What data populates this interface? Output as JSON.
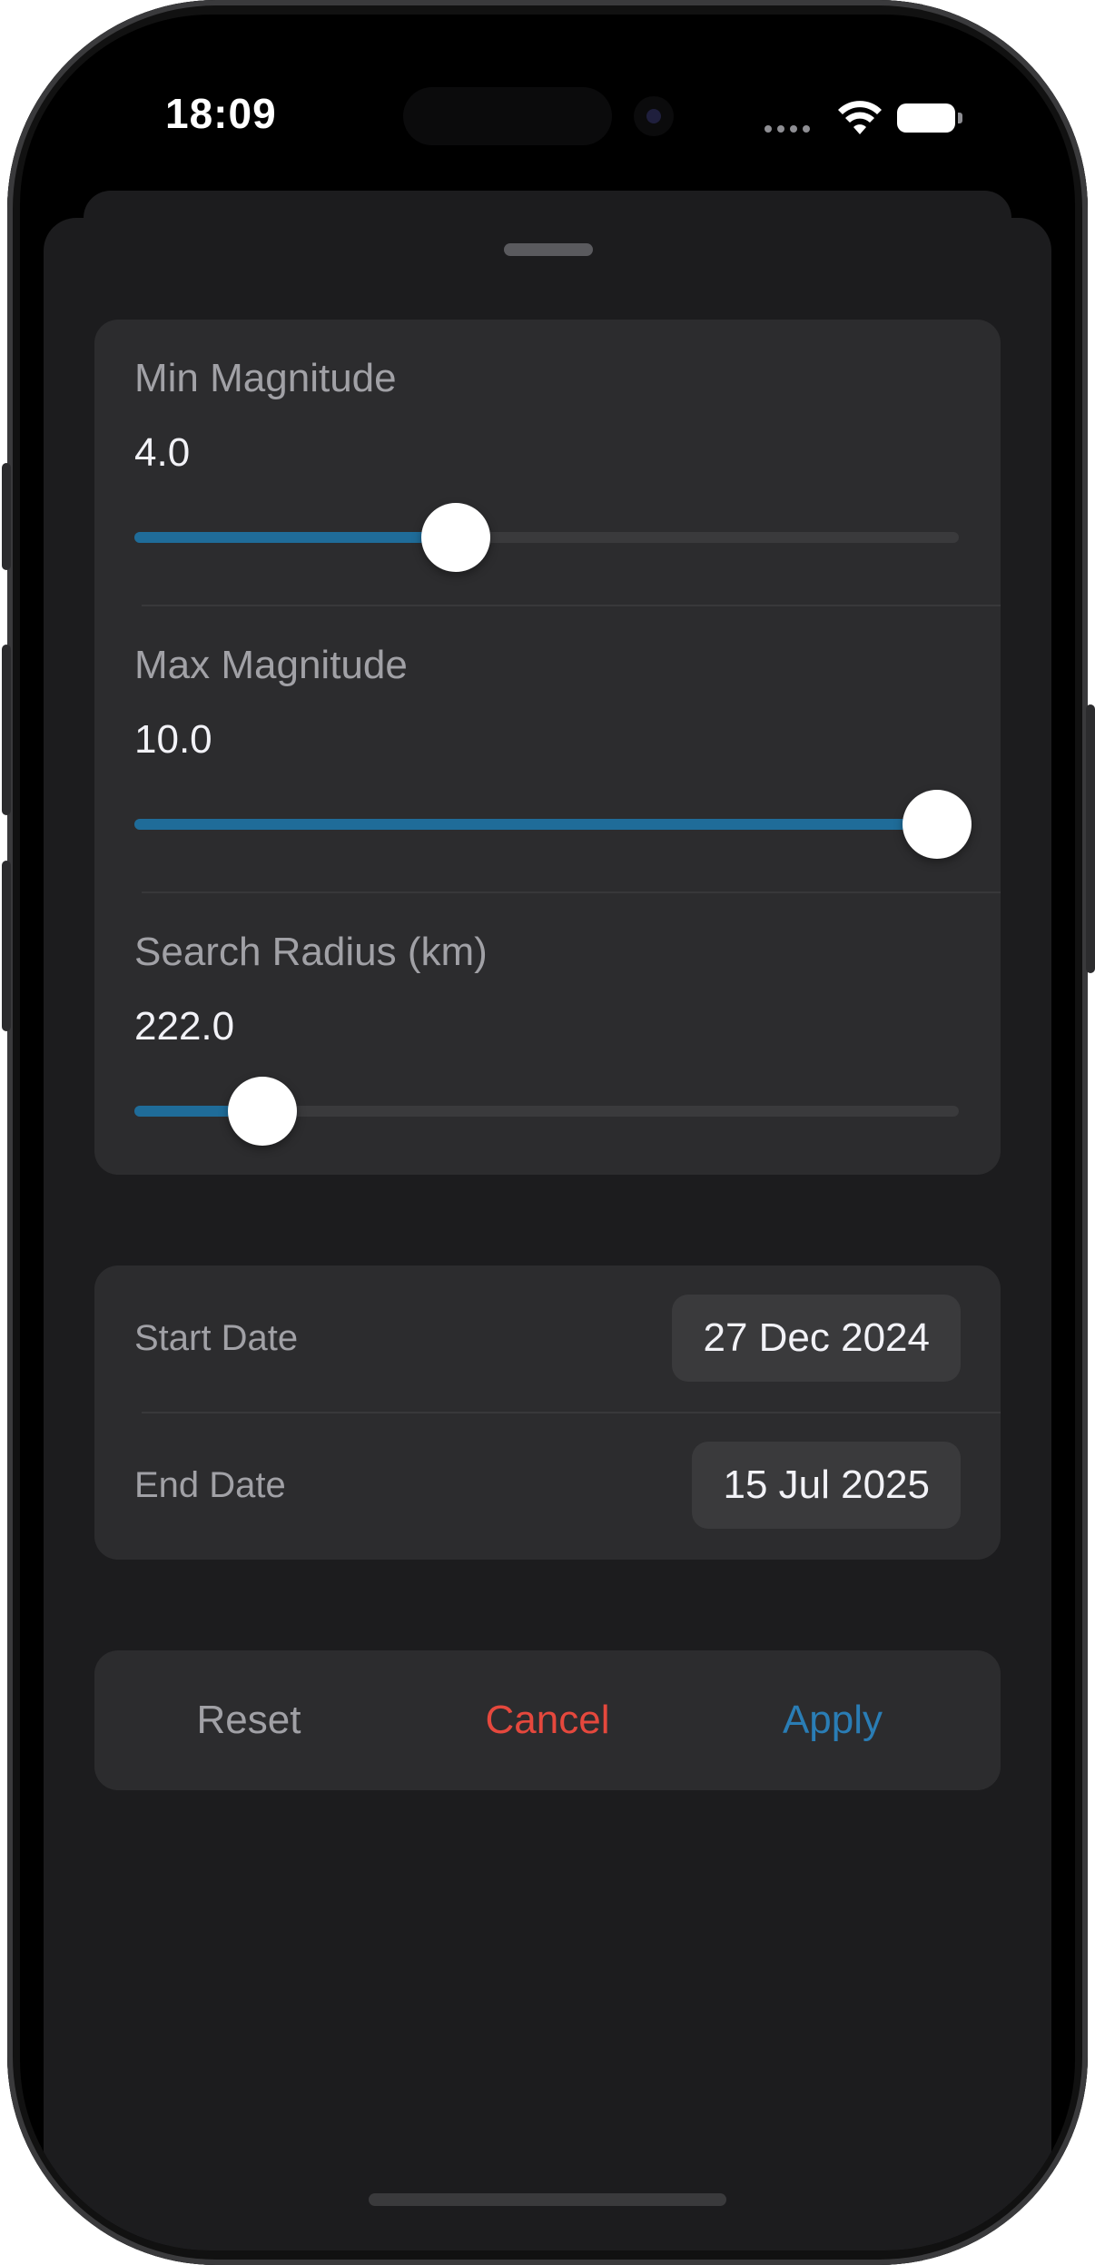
{
  "status_bar": {
    "time": "18:09",
    "icons": [
      "signal-dots-icon",
      "wifi-icon",
      "battery-icon"
    ]
  },
  "sliders": [
    {
      "label": "Min Magnitude",
      "value": "4.0",
      "fraction": 0.4
    },
    {
      "label": "Max Magnitude",
      "value": "10.0",
      "fraction": 1.0
    },
    {
      "label": "Search Radius (km)",
      "value": "222.0",
      "fraction": 0.16
    }
  ],
  "dates": {
    "start_label": "Start Date",
    "start_value": "27 Dec 2024",
    "end_label": "End Date",
    "end_value": "15 Jul 2025"
  },
  "actions": {
    "reset": "Reset",
    "cancel": "Cancel",
    "apply": "Apply"
  },
  "colors": {
    "accent": "#1f6c99",
    "destructive": "#e5483d",
    "neutral": "#a1a1a6",
    "apply": "#2a7db5"
  }
}
